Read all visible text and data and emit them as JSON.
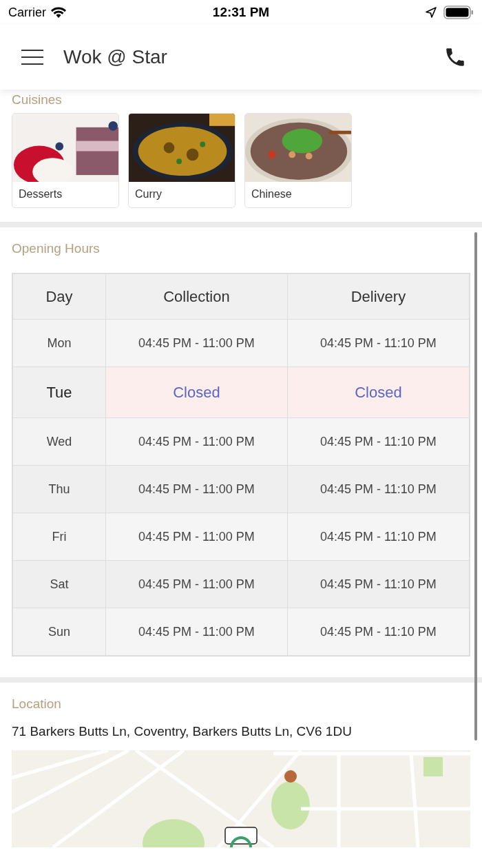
{
  "status_bar": {
    "carrier": "Carrier",
    "time": "12:31 PM"
  },
  "header": {
    "title": "Wok @ Star"
  },
  "cuisines": {
    "title": "Cuisines",
    "items": [
      {
        "label": "Desserts",
        "kind": "picture"
      },
      {
        "label": "Curry",
        "kind": "picture"
      },
      {
        "label": "Chinese",
        "kind": "picture"
      }
    ]
  },
  "opening_hours": {
    "title": "Opening Hours",
    "columns": [
      "Day",
      "Collection",
      "Delivery"
    ],
    "rows": [
      {
        "day": "Mon",
        "closed": false,
        "collection": "04:45 PM - 11:00 PM",
        "delivery": "04:45 PM - 11:10 PM"
      },
      {
        "day": "Tue",
        "closed": true,
        "collection": "Closed",
        "delivery": "Closed"
      },
      {
        "day": "Wed",
        "closed": false,
        "collection": "04:45 PM - 11:00 PM",
        "delivery": "04:45 PM - 11:10 PM"
      },
      {
        "day": "Thu",
        "closed": false,
        "collection": "04:45 PM - 11:00 PM",
        "delivery": "04:45 PM - 11:10 PM"
      },
      {
        "day": "Fri",
        "closed": false,
        "collection": "04:45 PM - 11:00 PM",
        "delivery": "04:45 PM - 11:10 PM"
      },
      {
        "day": "Sat",
        "closed": false,
        "collection": "04:45 PM - 11:00 PM",
        "delivery": "04:45 PM - 11:10 PM"
      },
      {
        "day": "Sun",
        "closed": false,
        "collection": "04:45 PM - 11:00 PM",
        "delivery": "04:45 PM - 11:10 PM"
      }
    ]
  },
  "location": {
    "title": "Location",
    "address": "71 Barkers Butts Ln, Coventry, Barkers Butts Ln, CV6 1DU"
  }
}
